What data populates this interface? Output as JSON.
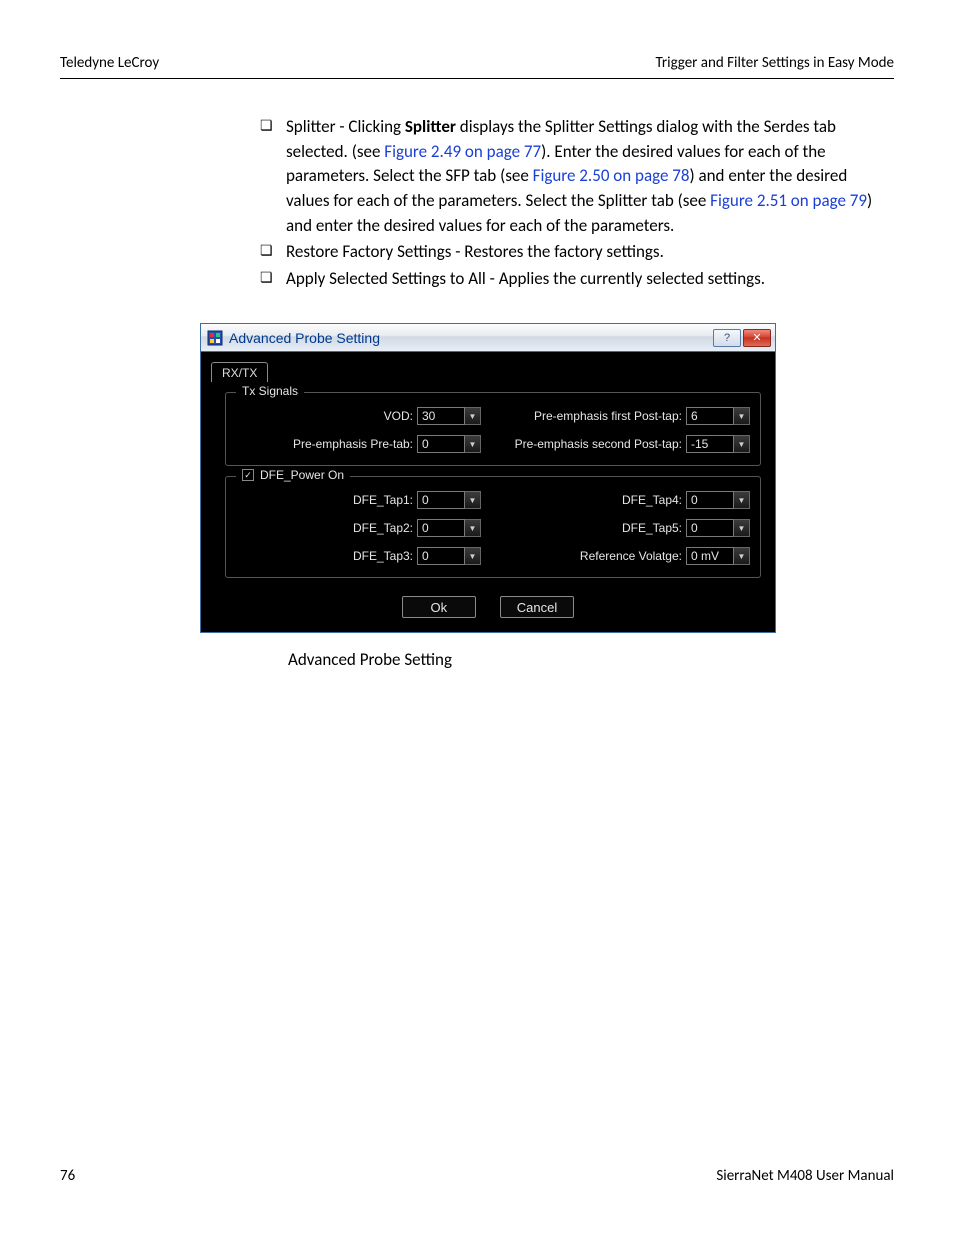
{
  "header": {
    "left": "Teledyne LeCroy",
    "right": "Trigger and Filter Settings in Easy Mode"
  },
  "bullets": {
    "splitter": {
      "pre": "Splitter - Clicking ",
      "bold": "Splitter",
      "post1": " displays the Splitter Settings dialog with the Serdes tab selected. (see ",
      "link1": "Figure 2.49 on page 77",
      "post2": "). Enter the desired values for each of the parameters. Select the SFP tab (see ",
      "link2": "Figure 2.50 on page 78",
      "post3": ") and enter the desired values for each of the parameters. Select the Splitter tab (see ",
      "link3": "Figure 2.51 on page 79",
      "post4": ") and enter the desired values for each of the parameters."
    },
    "restore": "Restore Factory Settings - Restores the factory settings.",
    "apply": "Apply Selected Settings to All - Applies the currently selected settings."
  },
  "dialog": {
    "title": "Advanced Probe Setting",
    "tab": "RX/TX",
    "txGroup": {
      "legend": "Tx Signals",
      "vodLabel": "VOD:",
      "vodValue": "30",
      "preTabLabel": "Pre-emphasis Pre-tab:",
      "preTabValue": "0",
      "firstPostLabel": "Pre-emphasis first Post-tap:",
      "firstPostValue": "6",
      "secondPostLabel": "Pre-emphasis second Post-tap:",
      "secondPostValue": "-15"
    },
    "dfeGroup": {
      "legend": "DFE_Power On",
      "tap1Label": "DFE_Tap1:",
      "tap1Value": "0",
      "tap2Label": "DFE_Tap2:",
      "tap2Value": "0",
      "tap3Label": "DFE_Tap3:",
      "tap3Value": "0",
      "tap4Label": "DFE_Tap4:",
      "tap4Value": "0",
      "tap5Label": "DFE_Tap5:",
      "tap5Value": "0",
      "refVLabel": "Reference Volatge:",
      "refVValue": "0 mV"
    },
    "ok": "Ok",
    "cancel": "Cancel"
  },
  "caption": "Advanced Probe Setting",
  "footer": {
    "page": "76",
    "manual": "SierraNet M408 User Manual"
  },
  "glyphs": {
    "help": "?",
    "close": "✕",
    "check": "✓",
    "down": "▼"
  }
}
